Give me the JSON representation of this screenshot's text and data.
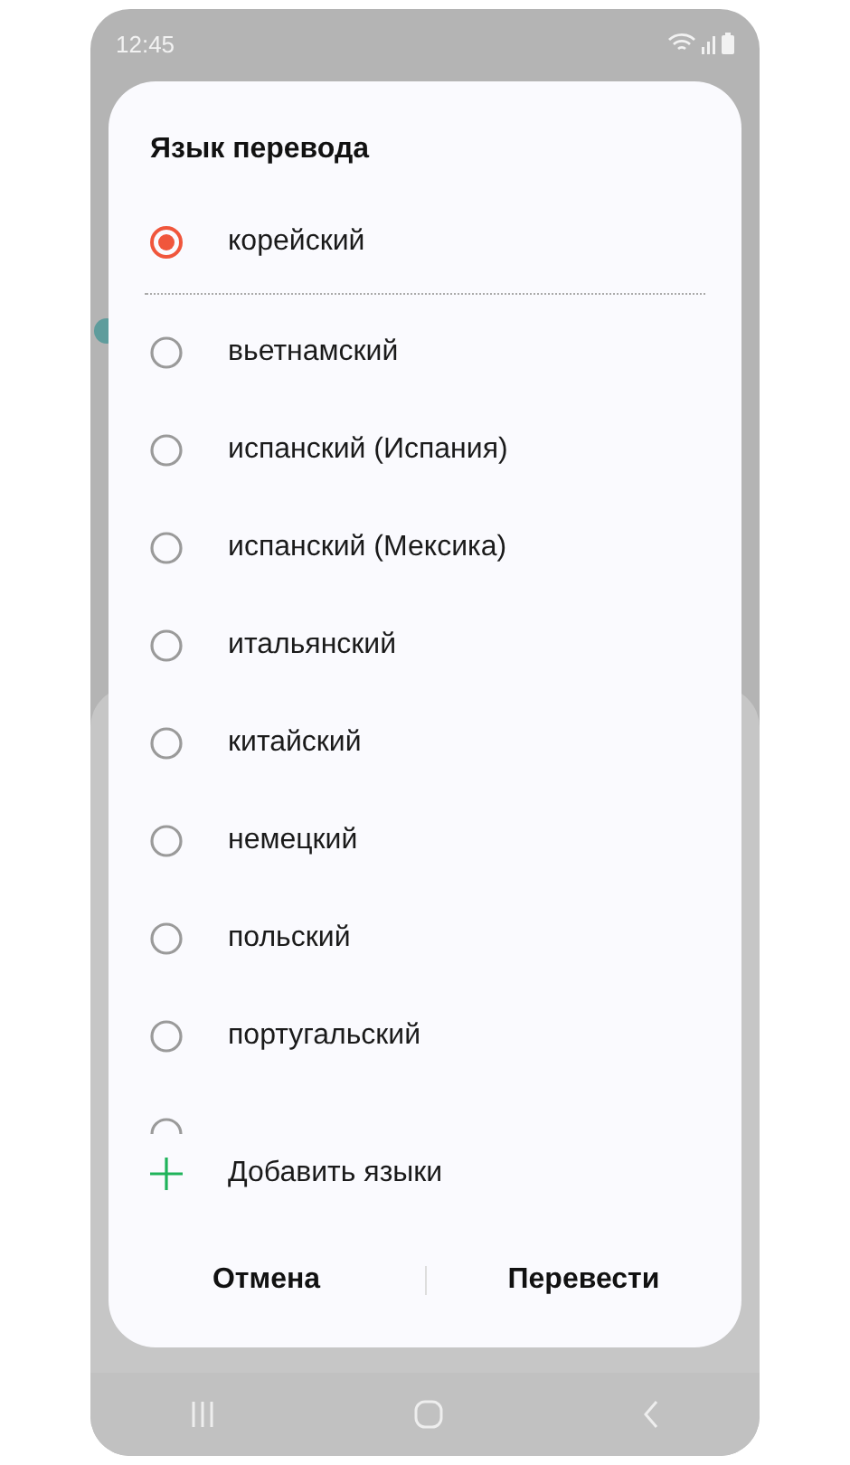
{
  "status_bar": {
    "time": "12:45"
  },
  "dialog": {
    "title": "Язык перевода",
    "languages": [
      {
        "label": "корейский",
        "selected": true
      },
      {
        "label": "вьетнамский",
        "selected": false
      },
      {
        "label": "испанский (Испания)",
        "selected": false
      },
      {
        "label": "испанский (Мексика)",
        "selected": false
      },
      {
        "label": "итальянский",
        "selected": false
      },
      {
        "label": "китайский",
        "selected": false
      },
      {
        "label": "немецкий",
        "selected": false
      },
      {
        "label": "польский",
        "selected": false
      },
      {
        "label": "португальский",
        "selected": false
      },
      {
        "selected": false
      }
    ],
    "add_button": "Добавить языки",
    "buttons": [
      "Отмена",
      "Перевести"
    ]
  }
}
